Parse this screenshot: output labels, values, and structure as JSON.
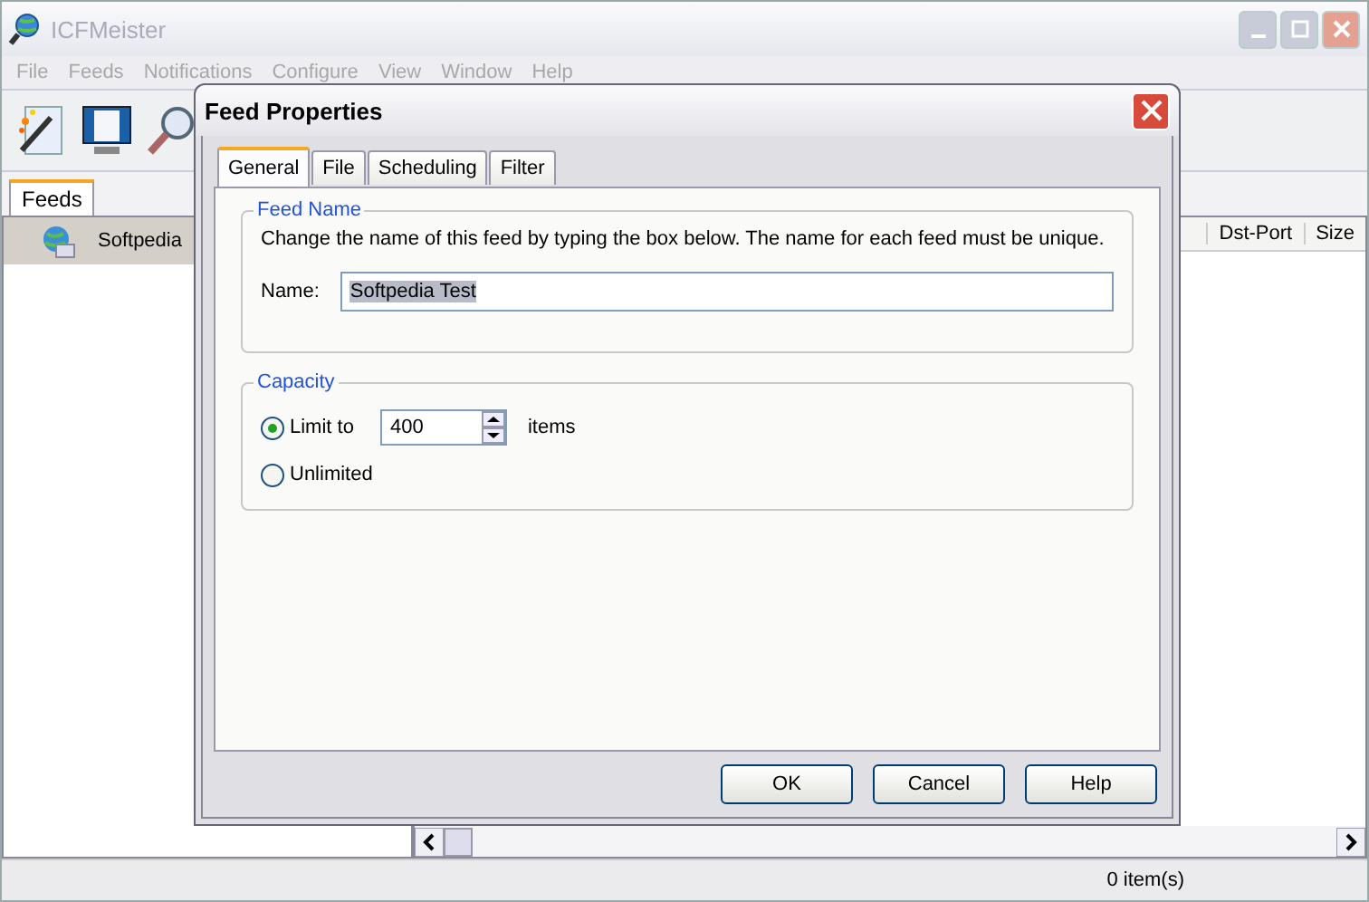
{
  "window": {
    "title": "ICFMeister"
  },
  "menu": [
    {
      "label": "File",
      "disabled": true
    },
    {
      "label": "Feeds",
      "disabled": true
    },
    {
      "label": "Notifications",
      "disabled": true
    },
    {
      "label": "Configure",
      "disabled": true
    },
    {
      "label": "View",
      "disabled": true
    },
    {
      "label": "Window",
      "disabled": true
    },
    {
      "label": "Help",
      "disabled": true
    }
  ],
  "side_tabs": [
    {
      "label": "Feeds",
      "selected": true
    }
  ],
  "feeds": [
    {
      "name": "Softpedia",
      "selected": true
    }
  ],
  "table": {
    "columns": [
      "Dst-Port",
      "Size"
    ]
  },
  "status_bar": {
    "count": "0 item(s)"
  },
  "dialog": {
    "title": "Feed Properties",
    "tabs": [
      {
        "label": "General",
        "selected": true
      },
      {
        "label": "File",
        "selected": false
      },
      {
        "label": "Scheduling",
        "selected": false
      },
      {
        "label": "Filter",
        "selected": false
      }
    ],
    "feed_name": {
      "legend": "Feed Name",
      "description": "Change the name of this feed by typing the box below. The name for each feed must be unique.",
      "label": "Name:",
      "value": "Softpedia Test"
    },
    "capacity": {
      "legend": "Capacity",
      "options": [
        {
          "label": "Limit to",
          "selected": true
        },
        {
          "label": "Unlimited",
          "selected": false
        }
      ],
      "value": "400",
      "unit": "items"
    },
    "buttons": [
      "OK",
      "Cancel",
      "Help"
    ]
  }
}
